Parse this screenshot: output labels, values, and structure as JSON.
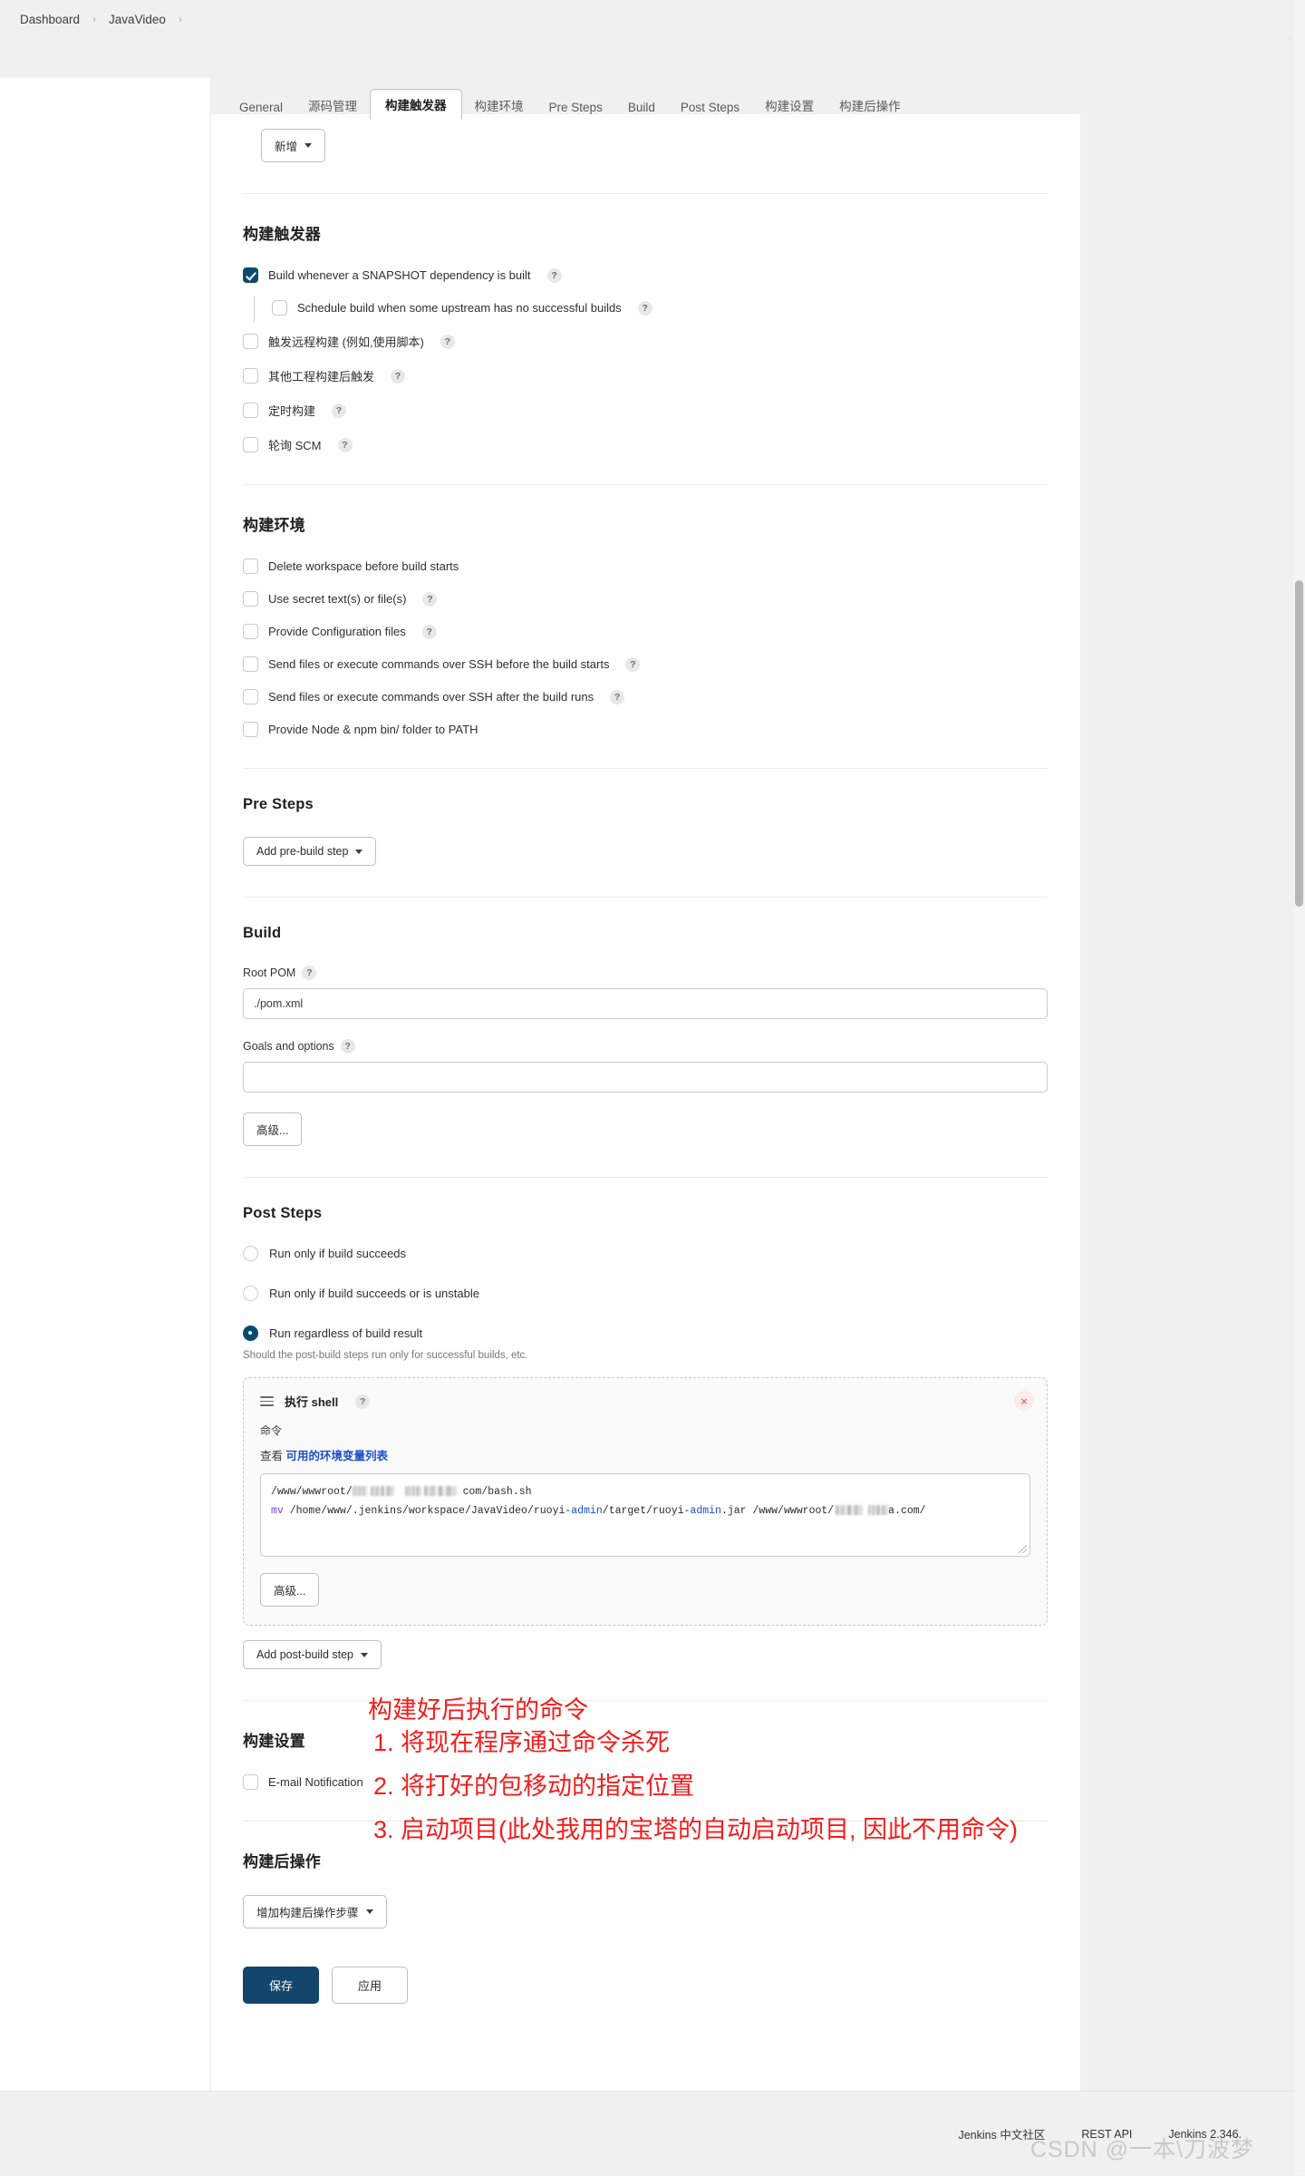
{
  "breadcrumb": {
    "items": [
      "Dashboard",
      "JavaVideo"
    ],
    "separator": "›"
  },
  "tabs": [
    {
      "label": "General",
      "active": false
    },
    {
      "label": "源码管理",
      "active": false
    },
    {
      "label": "构建触发器",
      "active": true
    },
    {
      "label": "构建环境",
      "active": false
    },
    {
      "label": "Pre Steps",
      "active": false
    },
    {
      "label": "Build",
      "active": false
    },
    {
      "label": "Post Steps",
      "active": false
    },
    {
      "label": "构建设置",
      "active": false
    },
    {
      "label": "构建后操作",
      "active": false
    }
  ],
  "top_partial": {
    "button_label": "新增"
  },
  "build_triggers": {
    "title": "构建触发器",
    "items": [
      {
        "label": "Build whenever a SNAPSHOT dependency is built",
        "checked": true,
        "help": "?",
        "indent": false
      },
      {
        "label": "Schedule build when some upstream has no successful builds",
        "checked": false,
        "help": "?",
        "indent": true
      },
      {
        "label": "触发远程构建 (例如,使用脚本)",
        "checked": false,
        "help": "?",
        "indent": false
      },
      {
        "label": "其他工程构建后触发",
        "checked": false,
        "help": "?",
        "indent": false
      },
      {
        "label": "定时构建",
        "checked": false,
        "help": "?",
        "indent": false
      },
      {
        "label": "轮询 SCM",
        "checked": false,
        "help": "?",
        "indent": false
      }
    ]
  },
  "build_environment": {
    "title": "构建环境",
    "items": [
      {
        "label": "Delete workspace before build starts",
        "checked": false,
        "help": ""
      },
      {
        "label": "Use secret text(s) or file(s)",
        "checked": false,
        "help": "?"
      },
      {
        "label": "Provide Configuration files",
        "checked": false,
        "help": "?"
      },
      {
        "label": "Send files or execute commands over SSH before the build starts",
        "checked": false,
        "help": "?"
      },
      {
        "label": "Send files or execute commands over SSH after the build runs",
        "checked": false,
        "help": "?"
      },
      {
        "label": "Provide Node & npm bin/ folder to PATH",
        "checked": false,
        "help": ""
      }
    ]
  },
  "pre_steps": {
    "title": "Pre Steps",
    "add_button": "Add pre-build step"
  },
  "build": {
    "title": "Build",
    "root_pom_label": "Root POM",
    "root_pom_help": "?",
    "root_pom_value": "./pom.xml",
    "goals_label": "Goals and options",
    "goals_help": "?",
    "goals_value": "",
    "advanced_button": "高级..."
  },
  "post_steps": {
    "title": "Post Steps",
    "options": [
      {
        "label": "Run only if build succeeds",
        "selected": false
      },
      {
        "label": "Run only if build succeeds or is unstable",
        "selected": false
      },
      {
        "label": "Run regardless of build result",
        "selected": true
      }
    ],
    "hint": "Should the post-build steps run only for successful builds, etc.",
    "shell_step": {
      "title": "执行 shell",
      "help": "?",
      "close": "×",
      "command_label": "命令",
      "env_prefix": "查看",
      "env_link": "可用的环境变量列表",
      "command_line1_prefix": "/www/wwwroot/",
      "command_line1_suffix": "com/bash.sh",
      "command_line2_cmd": "mv",
      "command_line2_path": "/home/www/.jenkins/workspace/JavaVideo/ruoyi-admin/target/ruoyi-admin.jar",
      "command_line2_dest_prefix": "/www/wwwroot/",
      "command_line2_dest_suffix": "a.com/",
      "advanced_button": "高级..."
    },
    "add_post_button": "Add post-build step"
  },
  "build_settings": {
    "title": "构建设置",
    "items": [
      {
        "label": "E-mail Notification",
        "checked": false
      }
    ]
  },
  "post_build_actions": {
    "title": "构建后操作",
    "add_button": "增加构建后操作步骤"
  },
  "form_actions": {
    "save": "保存",
    "apply": "应用"
  },
  "annotations": {
    "lines": [
      "构建好后执行的命令",
      "1. 将现在程序通过命令杀死",
      "2. 将打好的包移动的指定位置",
      "3. 启动项目(此处我用的宝塔的自动启动项目, 因此不用命令)"
    ],
    "color": "#f41c1c"
  },
  "footer": {
    "links": [
      "Jenkins 中文社区",
      "REST API",
      "Jenkins 2.346."
    ],
    "watermark": "CSDN @一本\\刀波梦"
  }
}
